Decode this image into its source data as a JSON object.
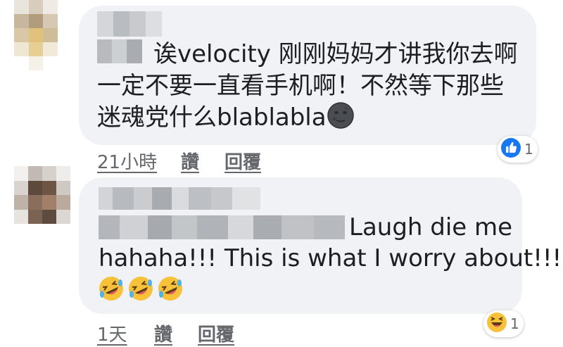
{
  "comments": [
    {
      "text_lines": [
        "诶velocity 刚刚妈妈才讲我你去啊",
        "一定不要一直看手机啊！不然等下那些",
        "迷魂党什么blablabla"
      ],
      "trailing_emoji": "new-moon-face-icon",
      "timestamp": "21小時",
      "like_label": "讚",
      "reply_label": "回覆",
      "reaction": {
        "icon": "like-reaction-icon",
        "count": "1"
      }
    },
    {
      "text_lines": [
        "Laugh die me",
        "hahaha!!! This is what I worry about!!!"
      ],
      "trailing_emoji": "rolling-on-floor-laughing-icon",
      "timestamp": "1天",
      "like_label": "讚",
      "reply_label": "回覆",
      "reaction": {
        "icon": "haha-reaction-icon",
        "count": "1"
      }
    }
  ],
  "colors": {
    "bubble": "#f0f2f5",
    "text": "#1c1e21",
    "meta": "#65676b",
    "like_blue": "#1877f2"
  }
}
